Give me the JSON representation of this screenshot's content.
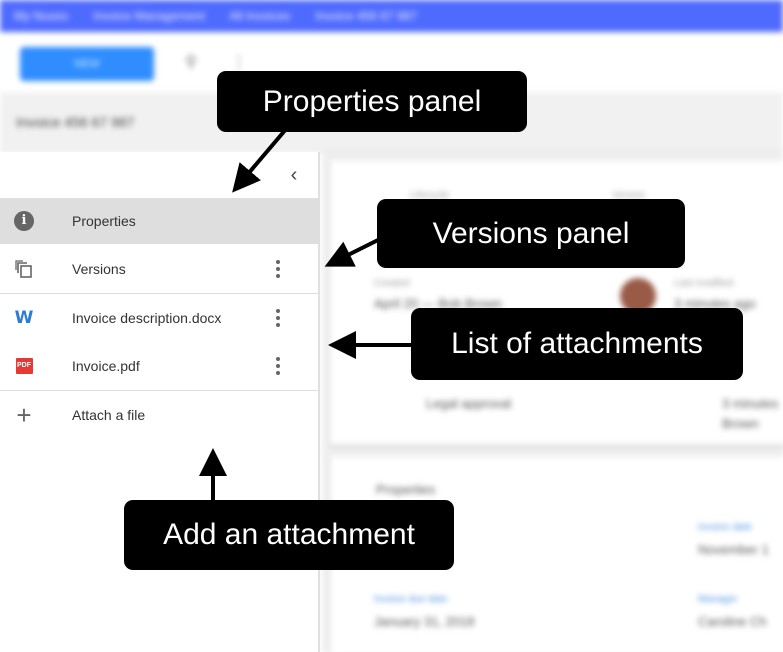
{
  "topbar": {
    "crumbs": [
      "My Nuxeo",
      "Invoice Management",
      "All Invoices",
      "Invoice 456 67 987"
    ]
  },
  "toolbar": {
    "new_label": "NEW"
  },
  "document": {
    "title": "Invoice 456 67 987"
  },
  "sidebar": {
    "items": [
      {
        "label": "Properties",
        "icon": "info-icon",
        "active": true
      },
      {
        "label": "Versions",
        "icon": "versions-icon"
      },
      {
        "label": "Invoice description.docx",
        "icon": "word-document-icon"
      },
      {
        "label": "Invoice.pdf",
        "icon": "pdf-icon",
        "icon_text": "PDF"
      },
      {
        "label": "Attach a file",
        "icon": "plus-icon"
      }
    ]
  },
  "content": {
    "lifecycle_label": "Lifecycle",
    "version_label": "Version",
    "created_label": "Created",
    "created_value": "April 20 — Bob Brown",
    "modified_label": "Last modified",
    "modified_value": "3 minutes ago",
    "task_value": "Legal approval",
    "task_meta": "3 minutes",
    "task_meta2": "Brown",
    "properties_heading": "Properties",
    "invoice_date_label": "Invoice date",
    "invoice_date_value": "November 1",
    "invoice_due_label": "Invoice due date",
    "invoice_due_value": "January 31, 2018",
    "manager_label": "Manager",
    "manager_value": "Caroline Ch"
  },
  "callouts": {
    "properties_panel": "Properties panel",
    "versions_panel": "Versions panel",
    "attachments": "List of attachments",
    "add_attachment": "Add an attachment"
  },
  "colors": {
    "topbar": "#4f6bff",
    "primary_button": "#2f8dff",
    "callout_bg": "#000000",
    "callout_text": "#ffffff",
    "active_row": "#dedede",
    "word_icon": "#2b7cd3",
    "pdf_icon": "#e53935"
  }
}
